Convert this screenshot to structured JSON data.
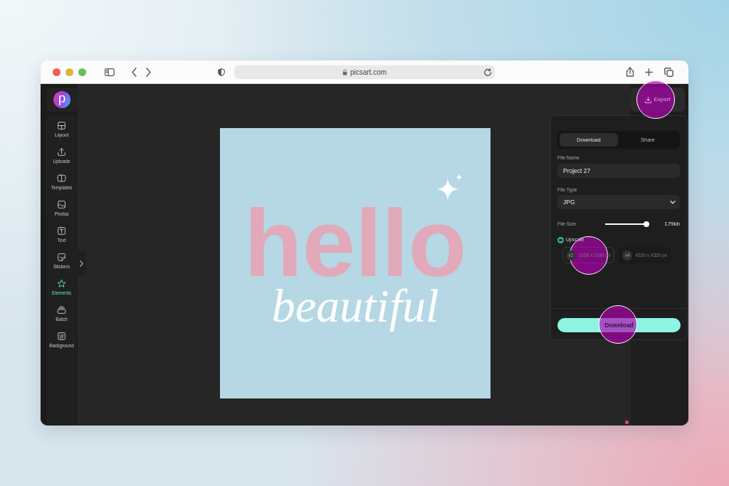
{
  "browser": {
    "address": "picsart.com"
  },
  "app_logo": {
    "letter": "p"
  },
  "sidebar": {
    "items": [
      {
        "label": "Layout",
        "selected": false
      },
      {
        "label": "Uploads",
        "selected": false
      },
      {
        "label": "Templates",
        "selected": false
      },
      {
        "label": "Photos",
        "selected": false
      },
      {
        "label": "Text",
        "selected": false
      },
      {
        "label": "Stickers",
        "selected": false
      },
      {
        "label": "Elements",
        "selected": true
      },
      {
        "label": "Batch",
        "selected": false
      },
      {
        "label": "Background",
        "selected": false
      }
    ]
  },
  "canvas": {
    "headline": "hello",
    "script_text": "beautiful"
  },
  "export_button": {
    "label": "Export",
    "highlighted": true
  },
  "export_panel": {
    "tabs": [
      {
        "label": "Download",
        "selected": true
      },
      {
        "label": "Share",
        "selected": false
      }
    ],
    "file_name": {
      "label": "File Name",
      "value": "Project 27"
    },
    "file_type": {
      "label": "File Type",
      "value": "JPG"
    },
    "file_size": {
      "label": "File Size",
      "level": 1,
      "reading": "179kb"
    },
    "upscale": {
      "label": "Upscale",
      "checked": true
    },
    "size_options": [
      {
        "badge": "x2",
        "label": "2160 x 2160 px",
        "selected": true,
        "highlighted": true
      },
      {
        "badge": "x4",
        "label": "4320 x 4320 px",
        "selected": false,
        "highlighted": false
      }
    ],
    "download_button": {
      "label": "Download",
      "highlighted": true
    }
  }
}
